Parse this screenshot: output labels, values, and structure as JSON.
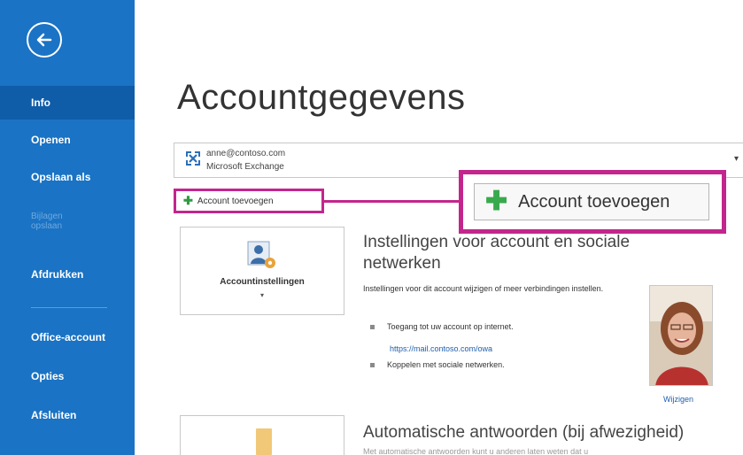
{
  "sidebar": {
    "items": [
      {
        "label": "Info",
        "active": true
      },
      {
        "label": "Openen"
      },
      {
        "label": "Opslaan als"
      },
      {
        "label": "Bijlagen opslaan",
        "disabled": true
      },
      {
        "label": "Afdrukken"
      },
      {
        "label": "Office-account"
      },
      {
        "label": "Opties"
      },
      {
        "label": "Afsluiten"
      }
    ]
  },
  "main": {
    "title": "Accountgegevens",
    "account": {
      "email": "anne@contoso.com",
      "type": "Microsoft Exchange"
    },
    "add_account_small": "Account toevoegen",
    "add_account_large": "Account toevoegen",
    "settings_tile": {
      "label": "Accountinstellingen",
      "caret": "▾"
    },
    "account_settings": {
      "heading": "Instellingen voor account en sociale netwerken",
      "description": "Instellingen voor dit account wijzigen of meer verbindingen instellen.",
      "bullet_web": "Toegang tot uw account op internet.",
      "web_link": "https://mail.contoso.com/owa",
      "bullet_social": "Koppelen met sociale netwerken.",
      "change_photo": "Wijzigen"
    },
    "auto_replies": {
      "heading": "Automatische antwoorden (bij afwezigheid)",
      "sub": "Met automatische antwoorden kunt u anderen laten weten dat u"
    }
  },
  "colors": {
    "sidebar": "#1a73c4",
    "sidebar_active": "#0f5ca8",
    "highlight": "#c2268d",
    "plus": "#2f9a43",
    "link": "#1f5fad"
  },
  "icons": {
    "back": "back-arrow-icon",
    "account": "exchange-account-icon",
    "settings": "account-settings-icon",
    "plus": "plus-icon"
  }
}
